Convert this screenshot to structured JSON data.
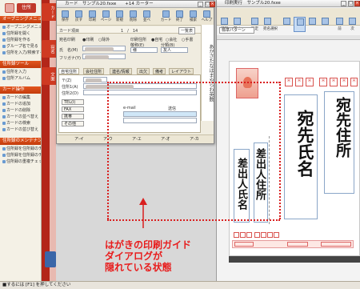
{
  "sidebar": {
    "logo_label": "住所",
    "sections": [
      {
        "label": "オープニングメニュー"
      },
      {
        "label": "住所録ツール"
      },
      {
        "label": "カード操作"
      },
      {
        "label": "住所録のメンテナンス"
      }
    ],
    "opening_items": [
      "オープニングメニューの表示",
      "住所録を開く",
      "住所録を作る",
      "グループ名で見る",
      "住所を入力/検索する"
    ],
    "tools_items": [
      "住所を入力",
      "住所アルバム"
    ],
    "card_items": [
      "カードの編集",
      "カードの追加",
      "カードの削除",
      "カードの並べ替え",
      "カードの検索",
      "カードの並び替え"
    ],
    "maint_items": [
      "住所録を住所録のチェック",
      "住所録を住所録のチェック",
      "住所録の重複チェック"
    ],
    "vertical_tabs": [
      "カード",
      "宛名",
      "文面"
    ]
  },
  "card_window": {
    "title": "カード　サンプル20.fxxe　　+14 カーター",
    "toolbar": [
      "保存",
      "戻す",
      "印刷",
      "ページ",
      "新規",
      "削除",
      "並べ",
      "",
      "カード",
      "終了",
      "検索",
      "ヘルプ"
    ],
    "page_indicator": "1　/　14",
    "edit_button": "一覧表",
    "menu_tab": "カード項目",
    "radio_row1_label": "宛名印刷",
    "radio_row1_opts": [
      "●印刷",
      "○除外"
    ],
    "radio_row2_label": "印刷住所",
    "radio_row2_opts": [
      "●自宅",
      "○会社",
      "○手書"
    ],
    "name_label": "氏　名(M)",
    "kana_label": "フリガナ(Y)",
    "title_label": "敬称(E)",
    "title_value": "様",
    "relation_label": "分類(B)",
    "relation_value": "友人",
    "tabs": [
      "自宅住所",
      "会社住所",
      "連名/情報",
      "出欠",
      "備考",
      "レイアウト"
    ],
    "home_fields": [
      "〒(Z)",
      "住所1(A)",
      "住所2(D)"
    ],
    "sub_buttons": [
      "TEL(I)",
      "FAX",
      "携帯",
      "その他"
    ],
    "email_label": "e-mail",
    "send_label": "送信",
    "footer_values": [
      "ア-イ",
      "ア-ウ",
      "ア-エ",
      "ア-オ",
      "ア-カ"
    ],
    "kana_index": "あかさたなはまやらわ英数"
  },
  "postcard_window": {
    "title": "印刷実行　サンプル20.fxxe",
    "toolbar": [
      "印刷",
      "開く",
      "",
      "設定",
      "宛名選択",
      "",
      "",
      "",
      "",
      "",
      "前",
      "次"
    ],
    "style_label": "標準パターン",
    "recipient_address": "宛先住所",
    "recipient_name": "宛先氏名",
    "sender_address": "差出人住所",
    "sender_name": "差出人氏名",
    "zip_marks": [
      "",
      "",
      "",
      "",
      "",
      "",
      ""
    ]
  },
  "annotation": {
    "caption_lines": [
      "はがきの印刷ガイド",
      "ダイアログが",
      "隠れている状態"
    ]
  },
  "statusbar": {
    "text": "■するには [F1] を押してください"
  },
  "colors": {
    "accent_red": "#d91f1f",
    "tab_red": "#b32619",
    "section_orange": "#d9471b"
  }
}
